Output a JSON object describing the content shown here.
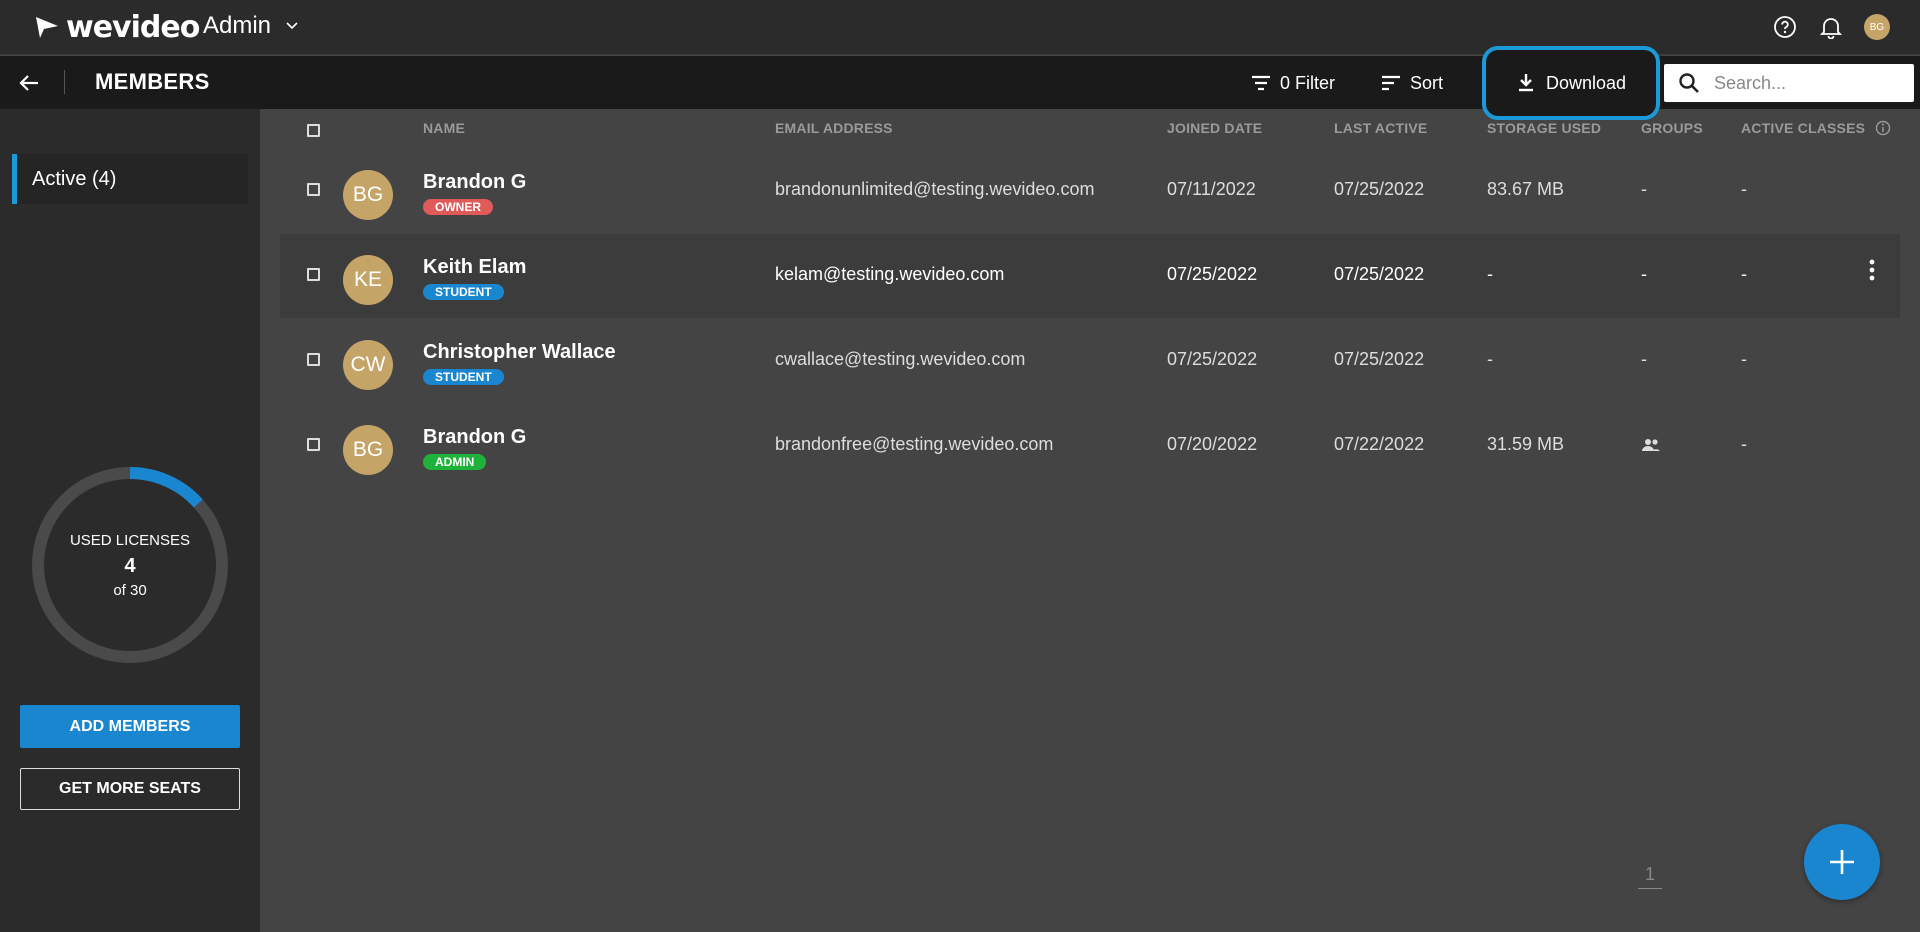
{
  "app": {
    "logo_text": "wevideo",
    "workspace": "Admin",
    "user_initials": "BG"
  },
  "subheader": {
    "title": "MEMBERS",
    "filter_label": "0 Filter",
    "sort_label": "Sort",
    "download_label": "Download",
    "search_placeholder": "Search..."
  },
  "sidebar": {
    "active_tab": "Active (4)",
    "licenses": {
      "label": "USED LICENSES",
      "used": "4",
      "of_text": "of 30",
      "used_fraction": 0.1333
    },
    "add_members": "ADD MEMBERS",
    "get_more_seats": "GET MORE SEATS"
  },
  "table": {
    "headers": {
      "name": "NAME",
      "email": "EMAIL ADDRESS",
      "joined": "JOINED DATE",
      "last_active": "LAST ACTIVE",
      "storage": "STORAGE USED",
      "groups": "GROUPS",
      "classes": "ACTIVE CLASSES"
    },
    "rows": [
      {
        "initials": "BG",
        "name": "Brandon G",
        "role": "OWNER",
        "email": "brandonunlimited@testing.wevideo.com",
        "joined": "07/11/2022",
        "last_active": "07/25/2022",
        "storage": "83.67 MB",
        "groups": "-",
        "classes": "-"
      },
      {
        "initials": "KE",
        "name": "Keith Elam",
        "role": "STUDENT",
        "email": "kelam@testing.wevideo.com",
        "joined": "07/25/2022",
        "last_active": "07/25/2022",
        "storage": "-",
        "groups": "-",
        "classes": "-"
      },
      {
        "initials": "CW",
        "name": "Christopher Wallace",
        "role": "STUDENT",
        "email": "cwallace@testing.wevideo.com",
        "joined": "07/25/2022",
        "last_active": "07/25/2022",
        "storage": "-",
        "groups": "-",
        "classes": "-"
      },
      {
        "initials": "BG",
        "name": "Brandon G",
        "role": "ADMIN",
        "email": "brandonfree@testing.wevideo.com",
        "joined": "07/20/2022",
        "last_active": "07/22/2022",
        "storage": "31.59 MB",
        "groups": "",
        "classes": "-"
      }
    ]
  },
  "pagination": {
    "current_page": "1"
  },
  "colors": {
    "accent": "#1a86d0",
    "owner": "#e05a5a",
    "student": "#1a86d0",
    "admin": "#1fb23b",
    "avatar": "#c5a467"
  }
}
